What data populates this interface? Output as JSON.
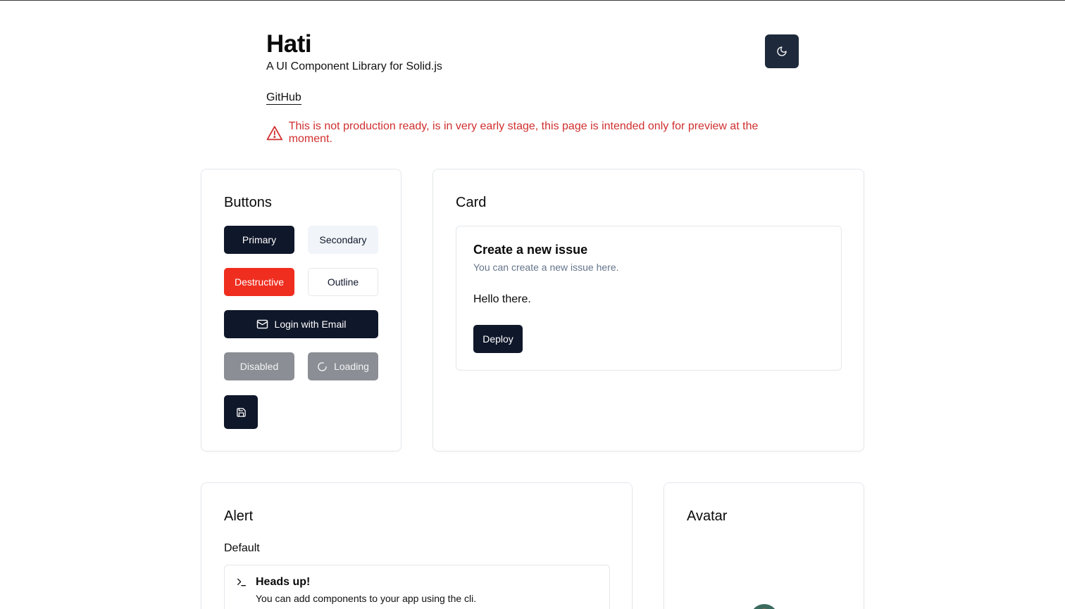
{
  "header": {
    "title": "Hati",
    "subtitle": "A UI Component Library for Solid.js",
    "github_label": "GitHub",
    "warning": "This is not production ready, is in very early stage, this page is intended only for preview at the moment.",
    "theme_toggle_icon": "moon-icon",
    "warning_icon": "alert-triangle-icon",
    "warning_color": "#d02f2f"
  },
  "buttons_card": {
    "title": "Buttons",
    "primary": "Primary",
    "secondary": "Secondary",
    "destructive": "Destructive",
    "outline": "Outline",
    "login_email": "Login with Email",
    "disabled": "Disabled",
    "loading": "Loading",
    "icon_button_icon": "save-icon",
    "login_icon": "mail-icon",
    "loading_icon": "spinner-icon"
  },
  "card_demo": {
    "title": "Card",
    "inner_title": "Create a new issue",
    "inner_description": "You can create a new issue here.",
    "inner_content": "Hello there.",
    "deploy_label": "Deploy"
  },
  "alert_card": {
    "title": "Alert",
    "section_label": "Default",
    "alert_title": "Heads up!",
    "alert_description": "You can add components to your app using the cli.",
    "alert_icon": "terminal-icon"
  },
  "avatar_card": {
    "title": "Avatar"
  },
  "colors": {
    "primary": "#0f172a",
    "secondary": "#f1f5f9",
    "destructive": "#ef2e1f",
    "disabled": "#8b8e94"
  }
}
